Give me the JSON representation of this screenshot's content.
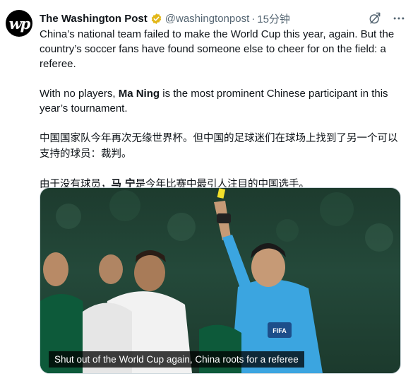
{
  "tweet": {
    "author_name": "The Washington Post",
    "handle": "@washingtonpost",
    "separator": "·",
    "time": "15分钟",
    "logo_text": "wp",
    "paragraph1": "China’s national team failed to make the World Cup this year, again. But the country’s soccer fans have found someone else to cheer for on the field: a referee.",
    "p2_prefix": "With no players, ",
    "p2_bold": "Ma Ning",
    "p2_suffix": " is the most prominent Chinese participant in this year’s tournament.",
    "zh_paragraph1": "中国国家队今年再次无缘世界杯。但中国的足球迷们在球场上找到了另一个可以支持的球员：裁判。",
    "zh_p2_prefix": "由于没有球员，",
    "zh_p2_bold": "马 宁",
    "zh_p2_suffix": "是今年比赛中最引人注目的中国选手。"
  },
  "media": {
    "caption": "Shut out of the World Cup again, China roots for a referee",
    "referee_badge": "FIFA"
  },
  "icons": {
    "verified": "verified-gold-badge-icon",
    "grok": "grok-icon",
    "more": "more-horizontal-icon"
  },
  "colors": {
    "verified_gold": "#e2b719",
    "secondary_text": "#536471",
    "referee_shirt": "#3ba5e0",
    "saudi_green": "#0d5a3a"
  }
}
